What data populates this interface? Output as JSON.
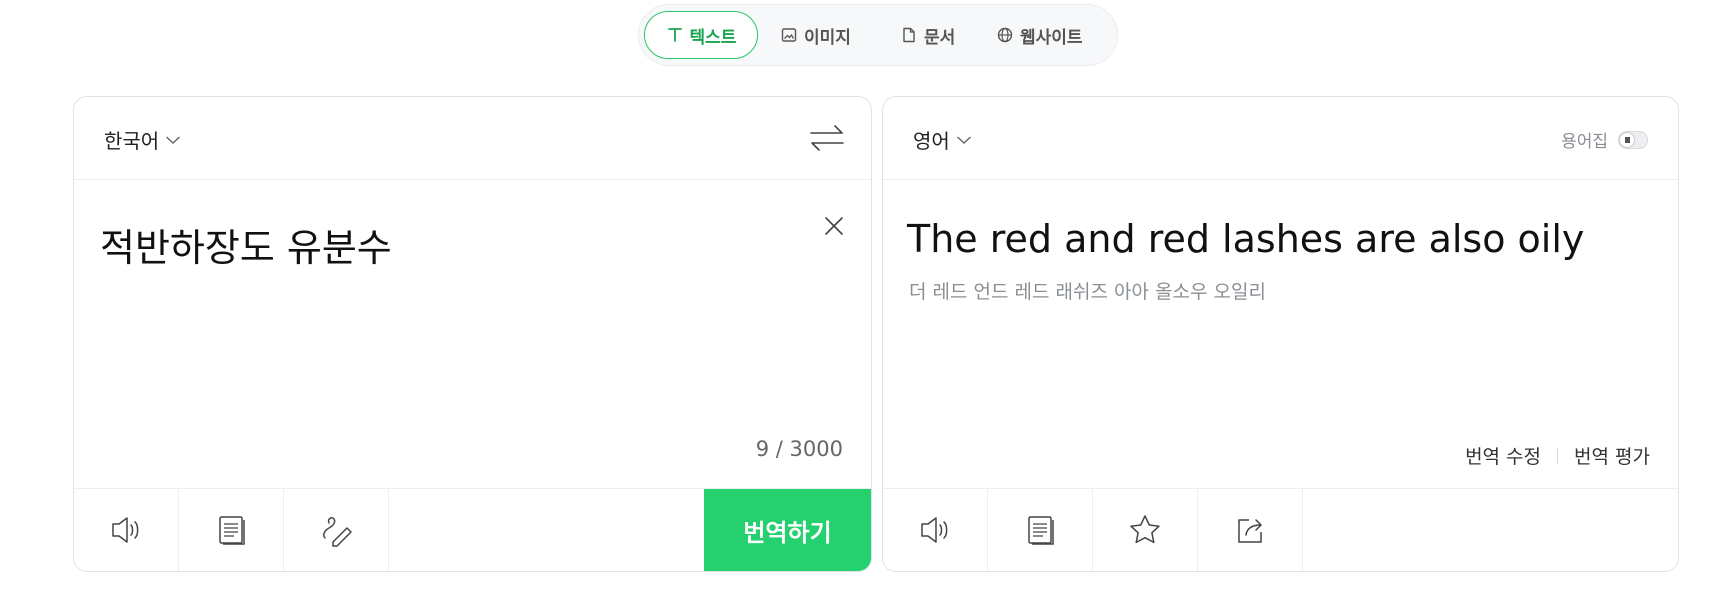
{
  "tabs": [
    {
      "label": "텍스트",
      "icon": "text-icon",
      "active": true
    },
    {
      "label": "이미지",
      "icon": "image-icon",
      "active": false
    },
    {
      "label": "문서",
      "icon": "document-icon",
      "active": false
    },
    {
      "label": "웹사이트",
      "icon": "globe-icon",
      "active": false
    }
  ],
  "source": {
    "language": "한국어",
    "text": "적반하장도 유분수",
    "char_count": "9 / 3000",
    "translate_label": "번역하기",
    "tools": [
      "speaker-icon",
      "copy-icon",
      "handwriting-icon"
    ]
  },
  "target": {
    "language": "영어",
    "glossary_label": "용어집",
    "glossary_enabled": false,
    "text": "The red and red lashes are also oily",
    "pronunciation": "더 레드 언드 레드 래쉬즈 아아 올소우 오일리",
    "edit_label": "번역 수정",
    "rate_label": "번역 평가",
    "tools": [
      "speaker-icon",
      "copy-icon",
      "star-icon",
      "share-icon"
    ]
  },
  "colors": {
    "accent": "#25d06e",
    "accent_text": "#1ba44f"
  }
}
